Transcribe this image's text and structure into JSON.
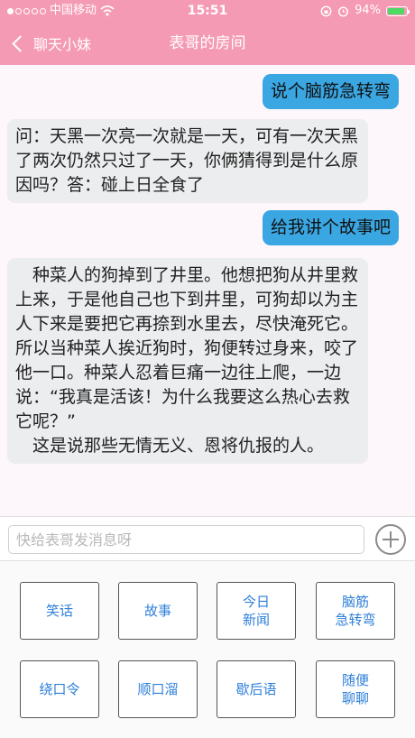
{
  "status": {
    "carrier": "中国移动",
    "time": "15:51",
    "battery": "94%",
    "battery_level": 0.94,
    "icons": [
      "signal-dots-icon",
      "wifi-icon",
      "rotation-lock-icon",
      "alarm-icon",
      "battery-icon"
    ]
  },
  "nav": {
    "back_label": "聊天小妹",
    "title": "表哥的房间"
  },
  "messages": [
    {
      "sender": "user",
      "text": "说个脑筋急转弯"
    },
    {
      "sender": "bot",
      "text": "问：天黑一次亮一次就是一天，可有一次天黑了两次仍然只过了一天，你俩猜得到是什么原因吗？答：碰上日全食了"
    },
    {
      "sender": "user",
      "text": "给我讲个故事吧"
    },
    {
      "sender": "bot",
      "paragraphs": [
        "　种菜人的狗掉到了井里。他想把狗从井里救上来，于是他自己也下到井里，可狗却以为主人下来是要把它再捺到水里去，尽快淹死它。所以当种菜人挨近狗时，狗便转过身来，咬了他一口。种菜人忍着巨痛一边往上爬，一边说：“我真是活该！为什么我要这么热心去救它呢？”",
        "　这是说那些无情无义、恩将仇报的人。"
      ]
    }
  ],
  "input": {
    "placeholder": "快给表哥发消息呀",
    "value": ""
  },
  "quick_buttons": [
    "笑话",
    "故事",
    "今日\n新闻",
    "脑筋\n急转弯",
    "绕口令",
    "顺口溜",
    "歇后语",
    "随便\n聊聊"
  ],
  "colors": {
    "header": "#f59ab4",
    "user_bubble": "#3aa7e3",
    "bot_bubble": "#ecedef",
    "button_text": "#2e7fd8"
  }
}
